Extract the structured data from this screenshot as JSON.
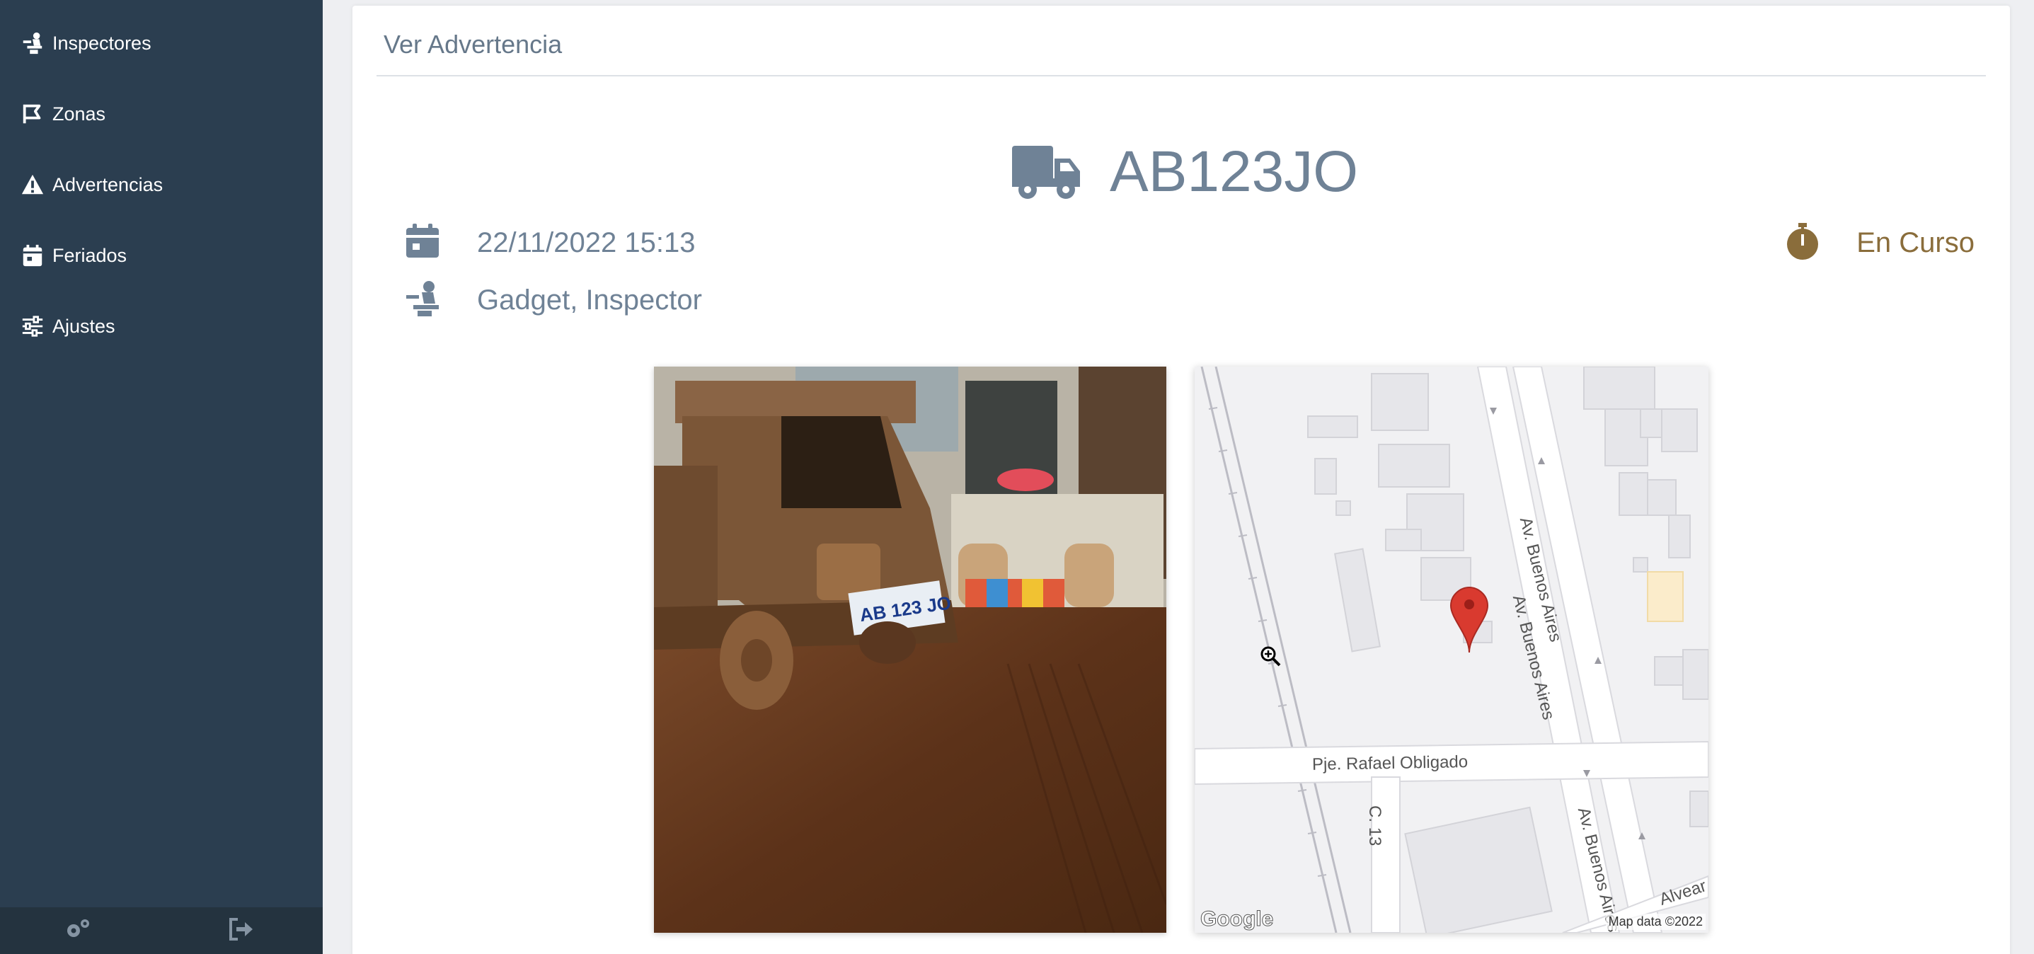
{
  "sidebar": {
    "items": [
      {
        "label": "Inspectores",
        "icon": "inspector-icon"
      },
      {
        "label": "Zonas",
        "icon": "zone-flag-icon"
      },
      {
        "label": "Advertencias",
        "icon": "warning-icon"
      },
      {
        "label": "Feriados",
        "icon": "calendar-icon"
      },
      {
        "label": "Ajustes",
        "icon": "sliders-icon"
      }
    ],
    "footer": [
      {
        "icon": "settings-cogs-icon"
      },
      {
        "icon": "logout-icon"
      }
    ]
  },
  "card": {
    "title": "Ver Advertencia",
    "plate": "AB123JO",
    "datetime": "22/11/2022 15:13",
    "inspector": "Gadget, Inspector",
    "status": "En Curso"
  },
  "map": {
    "streets": [
      "Av. Buenos Aires",
      "Av. Buenos Aires",
      "Pje. Rafael Obligado",
      "C. 13",
      "Av. Buenos Aires",
      "Alvear"
    ],
    "logo": "Google",
    "credit": "Map data ©2022"
  },
  "photo": {
    "plate_text": "AB 123 JO"
  },
  "colors": {
    "sidebar": "#2b3e50",
    "text_muted": "#6f8296",
    "status": "#8a6d3b",
    "pin": "#d93a2f"
  }
}
